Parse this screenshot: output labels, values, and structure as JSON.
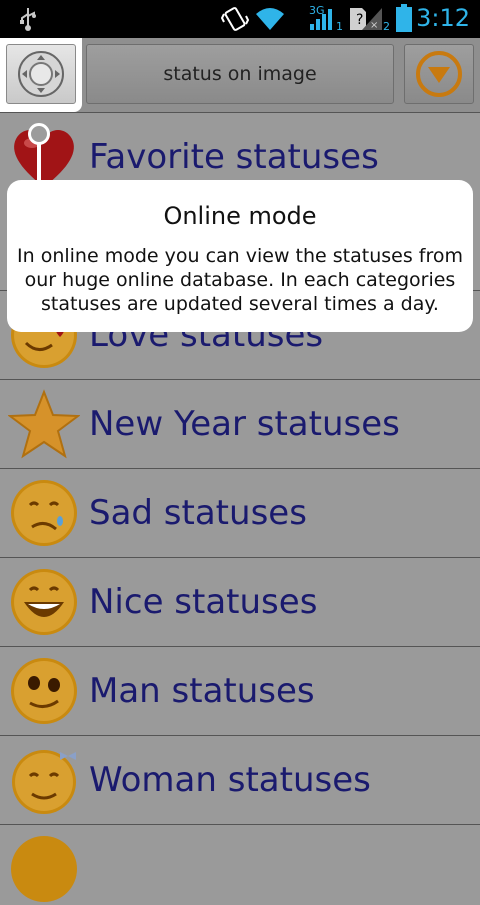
{
  "status_bar": {
    "time": "3:12",
    "network": "3G",
    "sim1": "1",
    "sim2": "2",
    "icons": [
      "usb-icon",
      "vibrate-icon",
      "wifi-icon",
      "signal-icon",
      "no-sim-icon",
      "battery-icon"
    ]
  },
  "toolbar": {
    "left_icon": "dpad-icon",
    "title": "status on image",
    "right_icon": "dropdown-circle-icon"
  },
  "list": {
    "items": [
      {
        "label": "Favorite statuses",
        "icon": "heart-icon"
      },
      {
        "label": "Love statuses",
        "icon": "love-smiley-icon"
      },
      {
        "label": "New Year statuses",
        "icon": "star-icon"
      },
      {
        "label": "Sad statuses",
        "icon": "sad-smiley-icon"
      },
      {
        "label": "Nice statuses",
        "icon": "grin-smiley-icon"
      },
      {
        "label": "Man statuses",
        "icon": "cool-smiley-icon"
      },
      {
        "label": "Woman statuses",
        "icon": "woman-smiley-icon"
      }
    ]
  },
  "tooltip": {
    "title": "Online mode",
    "body": "In online mode you can view the statuses from our huge online database. In each categories statuses are updated several times a day."
  },
  "colors": {
    "accent": "#2fb4e9",
    "list_text": "#1a1a6e",
    "overlay_bg": "#9a9a9a"
  }
}
